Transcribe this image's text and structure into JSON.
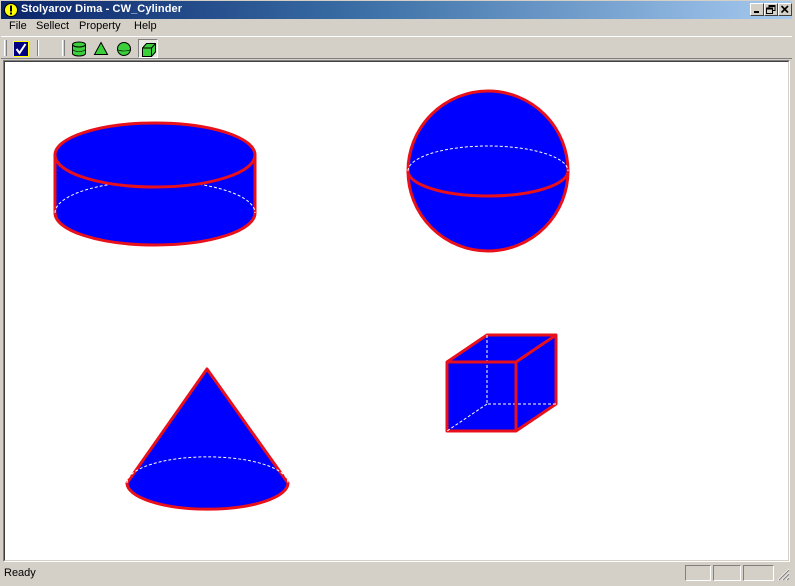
{
  "window": {
    "title": "Stolyarov Dima - CW_Cylinder"
  },
  "menu": {
    "file": "File",
    "select": "Sellect",
    "property": "Property",
    "help": "Help"
  },
  "toolbar": {
    "icons": [
      "check-icon",
      "cylinder-icon",
      "cone-icon",
      "sphere-icon",
      "cube-icon"
    ],
    "pressed": "cube-icon"
  },
  "status": {
    "text": "Ready"
  },
  "colors": {
    "fill": "#0000ff",
    "outline": "#e8101a",
    "titlebar_start": "#0a246a",
    "titlebar_end": "#a6caf0",
    "icon_green": "#3ccf3c"
  },
  "shapes": [
    "cylinder",
    "sphere",
    "cone",
    "cube"
  ]
}
